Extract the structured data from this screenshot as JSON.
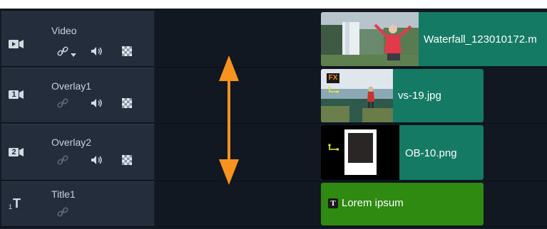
{
  "tracks": [
    {
      "name": "Video",
      "icon": "video-track-icon",
      "badge": ""
    },
    {
      "name": "Overlay1",
      "icon": "overlay-track-icon",
      "badge": "1"
    },
    {
      "name": "Overlay2",
      "icon": "overlay-track-icon",
      "badge": "2"
    },
    {
      "name": "Title1",
      "icon": "title-track-icon",
      "badge": "1"
    }
  ],
  "clips": {
    "video": {
      "label": "Waterfall_123010172.m",
      "color": "#157a63"
    },
    "overlay1": {
      "label": "vs-19.jpg",
      "fx_badge": "FX",
      "color": "#157a63"
    },
    "overlay2": {
      "label": "OB-10.png",
      "color": "#157a63"
    },
    "title": {
      "label": "Lorem ipsum",
      "badge": "T",
      "color": "#2f8a12"
    }
  },
  "title_track_glyph": "T",
  "colors": {
    "accent_arrow": "#f7931e",
    "header_bg": "#242d3b",
    "timeline_bg": "#121821"
  }
}
